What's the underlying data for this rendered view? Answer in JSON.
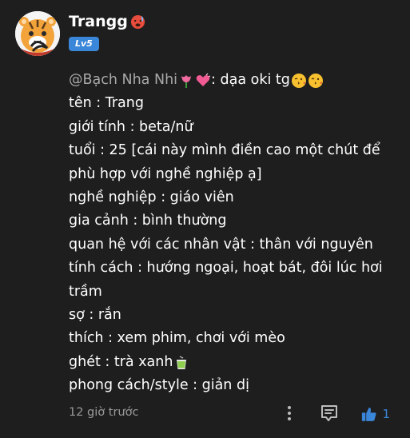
{
  "comment": {
    "username": "Trangg",
    "username_emoji": "hot-face-emoji",
    "level_badge": "Lv5",
    "mention": "@Bạch Nha Nhi",
    "mention_emojis": [
      "tulip-emoji",
      "pink-heart-emoji"
    ],
    "reply_lead": ": dạa oki tg",
    "reply_lead_emojis": [
      "face-blowing-kiss-emoji",
      "face-blowing-kiss-emoji"
    ],
    "lines": [
      "tên : Trang",
      "giới tính : beta/nữ",
      "tuổi : 25 [cái này mình điền cao một chút để phù hợp với nghề nghiệp ạ]",
      "nghề nghiệp : giáo viên",
      "gia cảnh : bình thường",
      "quan hệ với các nhân vật : thân với nguyên",
      "tính cách : hướng ngoại, hoạt bát, đôi lúc hơi trầm",
      "sợ : rắn",
      "thích : xem phim, chơi với mèo",
      "ghét : trà xanh",
      "phong cách/style : giản dị"
    ],
    "ghet_emoji": "green-tea-emoji",
    "timestamp": "12 giờ trước",
    "like_count": "1"
  },
  "colors": {
    "background": "#1e1e1e",
    "accent": "#3a86d8",
    "muted_text": "#9a9a9a"
  }
}
